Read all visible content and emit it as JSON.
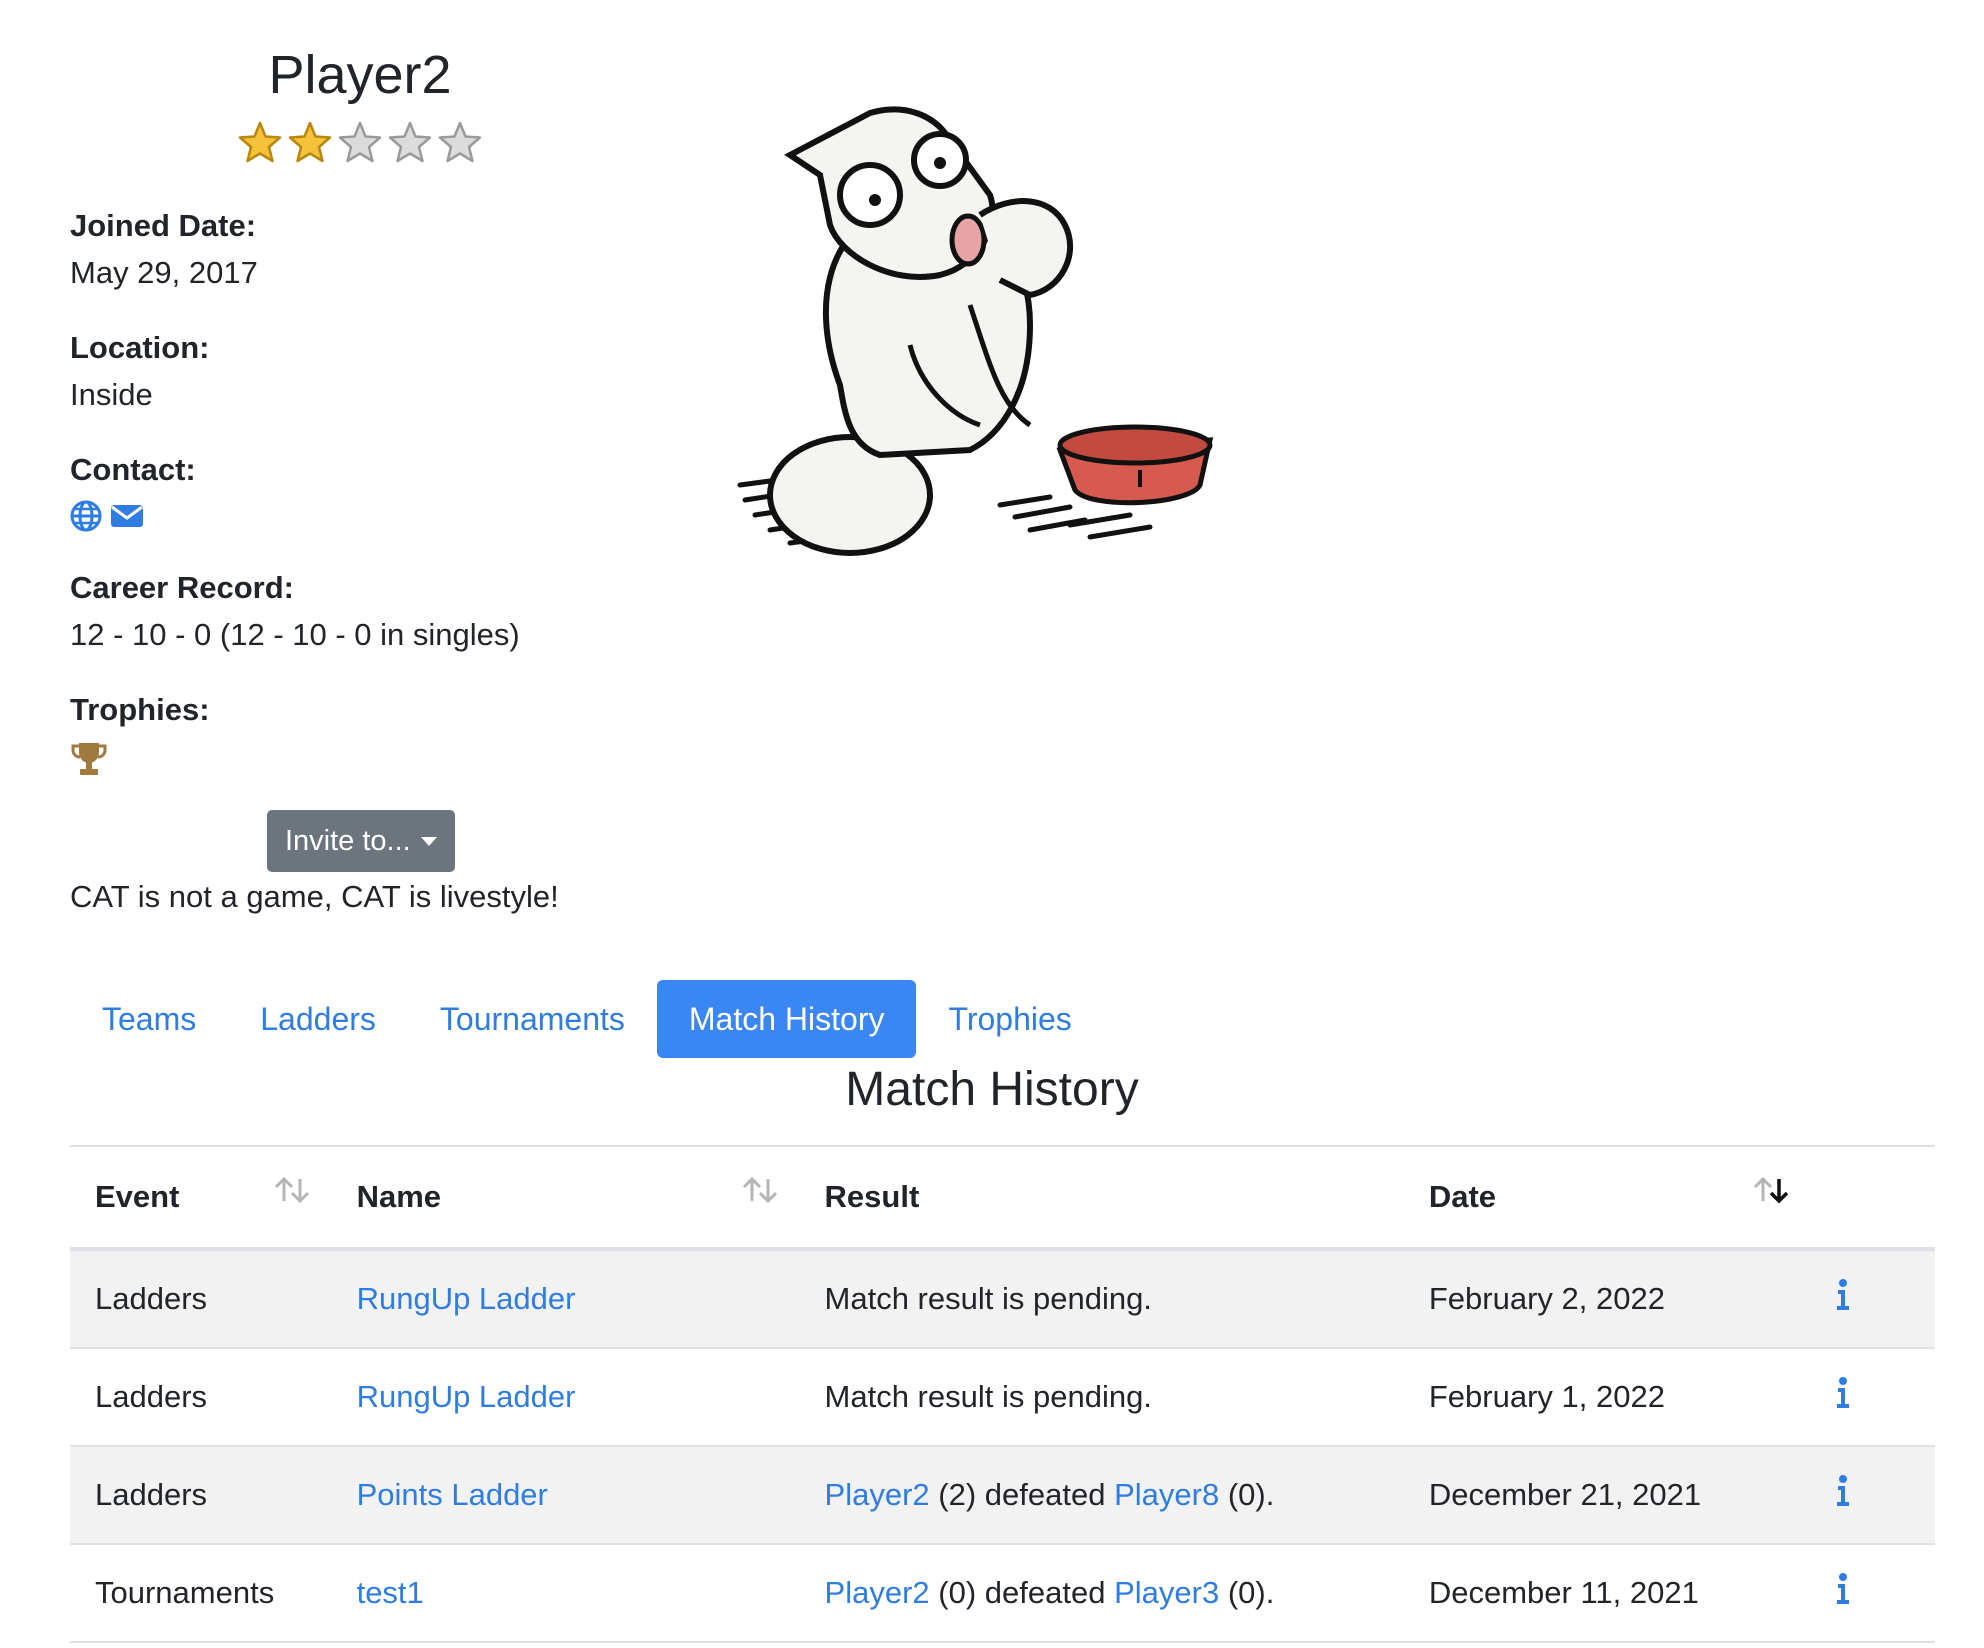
{
  "profile": {
    "name": "Player2",
    "rating": 2,
    "rating_max": 5,
    "joined_label": "Joined Date:",
    "joined_value": "May 29, 2017",
    "location_label": "Location:",
    "location_value": "Inside",
    "contact_label": "Contact:",
    "contact_icons": [
      "globe-icon",
      "envelope-icon"
    ],
    "career_label": "Career Record:",
    "career_value": "12 - 10 - 0 (12 - 10 - 0 in singles)",
    "trophies_label": "Trophies:",
    "trophy_icon": "trophy-icon",
    "invite_label": "Invite to...",
    "motto": "CAT is not a game, CAT is livestyle!"
  },
  "tabs": [
    {
      "label": "Teams",
      "active": false
    },
    {
      "label": "Ladders",
      "active": false
    },
    {
      "label": "Tournaments",
      "active": false
    },
    {
      "label": "Match History",
      "active": true
    },
    {
      "label": "Trophies",
      "active": false
    }
  ],
  "section_title": "Match History",
  "table": {
    "headers": {
      "event": "Event",
      "name": "Name",
      "result": "Result",
      "date": "Date"
    },
    "rows": [
      {
        "event": "Ladders",
        "name": "RungUp Ladder",
        "result_text": "Match result is pending.",
        "date": "February 2, 2022"
      },
      {
        "event": "Ladders",
        "name": "RungUp Ladder",
        "result_text": "Match result is pending.",
        "date": "February 1, 2022"
      },
      {
        "event": "Ladders",
        "name": "Points Ladder",
        "winner": "Player2",
        "winner_score": "(2)",
        "verb": "defeated",
        "loser": "Player8",
        "loser_score": "(0).",
        "date": "December 21, 2021"
      },
      {
        "event": "Tournaments",
        "name": "test1",
        "winner": "Player2",
        "winner_score": "(0)",
        "verb": "defeated",
        "loser": "Player3",
        "loser_score": "(0).",
        "date": "December 11, 2021"
      }
    ]
  },
  "colors": {
    "link": "#2f7de1",
    "active_tab": "#3a86f2",
    "button": "#6c757d",
    "stripe": "#f2f2f2"
  }
}
